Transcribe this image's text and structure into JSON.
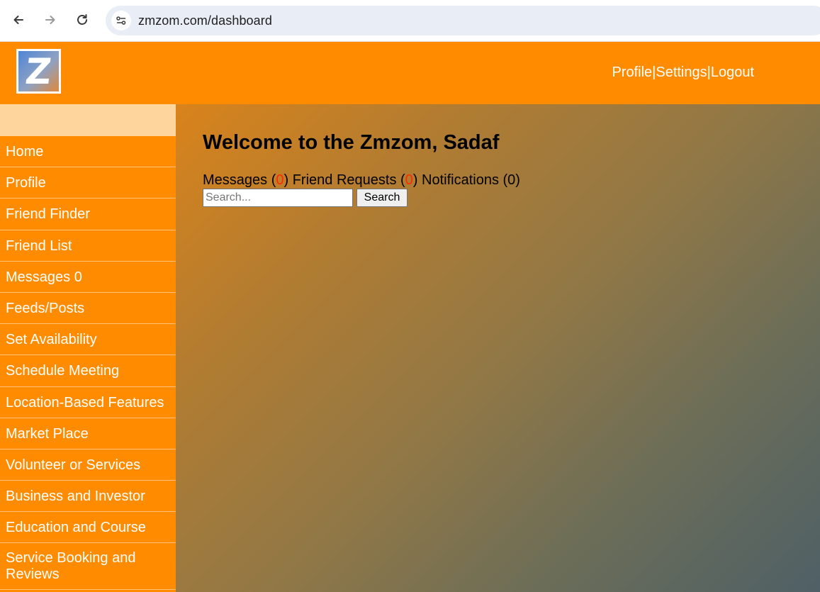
{
  "browser": {
    "url": "zmzom.com/dashboard"
  },
  "header": {
    "logo_letter": "Z",
    "links": {
      "profile": "Profile",
      "sep1": "|",
      "settings": "Settings",
      "sep2": "|",
      "logout": "Logout"
    }
  },
  "sidebar": {
    "items": [
      {
        "label": "Home"
      },
      {
        "label": "Profile"
      },
      {
        "label": "Friend Finder"
      },
      {
        "label": "Friend List"
      },
      {
        "label": "Messages 0"
      },
      {
        "label": "Feeds/Posts"
      },
      {
        "label": "Set Availability"
      },
      {
        "label": "Schedule Meeting"
      },
      {
        "label": "Location-Based Features"
      },
      {
        "label": "Market Place"
      },
      {
        "label": "Volunteer or Services"
      },
      {
        "label": "Business and Investor"
      },
      {
        "label": "Education and Course"
      },
      {
        "label": "Service Booking and Reviews"
      }
    ]
  },
  "main": {
    "welcome": "Welcome to the Zmzom, Sadaf",
    "counts": {
      "messages_label": "Messages (",
      "messages_value": "0",
      "friend_requests_label": ") Friend Requests (",
      "friend_requests_value": "0",
      "notifications_label": ") Notifications (0)"
    },
    "search": {
      "placeholder": "Search...",
      "button_label": "Search"
    }
  },
  "colors": {
    "header": "#ff8c00",
    "sidebar": "#ff8c00",
    "sidebar_top": "#ffd59e",
    "count_highlight": "#ff2a00"
  }
}
